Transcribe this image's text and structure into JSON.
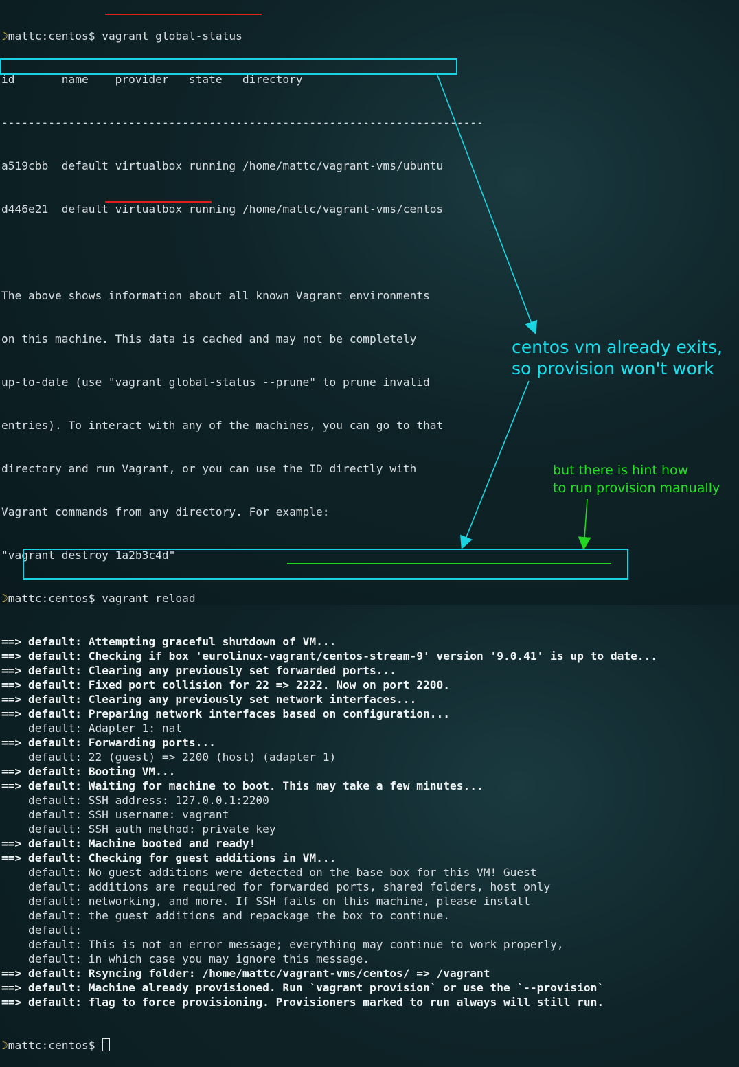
{
  "terminal": {
    "prompt": "mattc:centos$",
    "command1": "vagrant global-status",
    "header": "id       name    provider   state   directory",
    "separator": "------------------------------------------------------------------------",
    "row1": "a519cbb  default virtualbox running /home/mattc/vagrant-vms/ubuntu",
    "row2": "d446e21  default virtualbox running /home/mattc/vagrant-vms/centos",
    "info": [
      "The above shows information about all known Vagrant environments",
      "on this machine. This data is cached and may not be completely",
      "up-to-date (use \"vagrant global-status --prune\" to prune invalid",
      "entries). To interact with any of the machines, you can go to that",
      "directory and run Vagrant, or you can use the ID directly with",
      "Vagrant commands from any directory. For example:",
      "\"vagrant destroy 1a2b3c4d\""
    ],
    "command2": "vagrant reload",
    "arrow": "==>",
    "output": [
      {
        "bold": true,
        "text": "default: Attempting graceful shutdown of VM..."
      },
      {
        "bold": true,
        "text": "default: Checking if box 'eurolinux-vagrant/centos-stream-9' version '9.0.41' is up to date..."
      },
      {
        "bold": true,
        "text": "default: Clearing any previously set forwarded ports..."
      },
      {
        "bold": true,
        "text": "default: Fixed port collision for 22 => 2222. Now on port 2200."
      },
      {
        "bold": true,
        "text": "default: Clearing any previously set network interfaces..."
      },
      {
        "bold": true,
        "text": "default: Preparing network interfaces based on configuration..."
      },
      {
        "bold": false,
        "text": "default: Adapter 1: nat"
      },
      {
        "bold": true,
        "text": "default: Forwarding ports..."
      },
      {
        "bold": false,
        "text": "default: 22 (guest) => 2200 (host) (adapter 1)"
      },
      {
        "bold": true,
        "text": "default: Booting VM..."
      },
      {
        "bold": true,
        "text": "default: Waiting for machine to boot. This may take a few minutes..."
      },
      {
        "bold": false,
        "text": "default: SSH address: 127.0.0.1:2200"
      },
      {
        "bold": false,
        "text": "default: SSH username: vagrant"
      },
      {
        "bold": false,
        "text": "default: SSH auth method: private key"
      },
      {
        "bold": true,
        "text": "default: Machine booted and ready!"
      },
      {
        "bold": true,
        "text": "default: Checking for guest additions in VM..."
      },
      {
        "bold": false,
        "text": "default: No guest additions were detected on the base box for this VM! Guest"
      },
      {
        "bold": false,
        "text": "default: additions are required for forwarded ports, shared folders, host only"
      },
      {
        "bold": false,
        "text": "default: networking, and more. If SSH fails on this machine, please install"
      },
      {
        "bold": false,
        "text": "default: the guest additions and repackage the box to continue."
      },
      {
        "bold": false,
        "text": "default:"
      },
      {
        "bold": false,
        "text": "default: This is not an error message; everything may continue to work properly,"
      },
      {
        "bold": false,
        "text": "default: in which case you may ignore this message."
      },
      {
        "bold": true,
        "text": "default: Rsyncing folder: /home/mattc/vagrant-vms/centos/ => /vagrant"
      },
      {
        "bold": true,
        "text": "default: Machine already provisioned. Run `vagrant provision` or use the `--provision`"
      },
      {
        "bold": true,
        "text": "default: flag to force provisioning. Provisioners marked to run always will still run."
      }
    ]
  },
  "annotations": {
    "cyan_note": [
      "centos vm already exits,",
      "so provision won't work"
    ],
    "green_note": [
      "but there is hint how",
      "to run provision manually"
    ]
  },
  "colors": {
    "accent_cyan": "#19d4e0",
    "accent_green": "#22d622",
    "accent_red": "#e01e1e",
    "background": "#0f2428"
  }
}
